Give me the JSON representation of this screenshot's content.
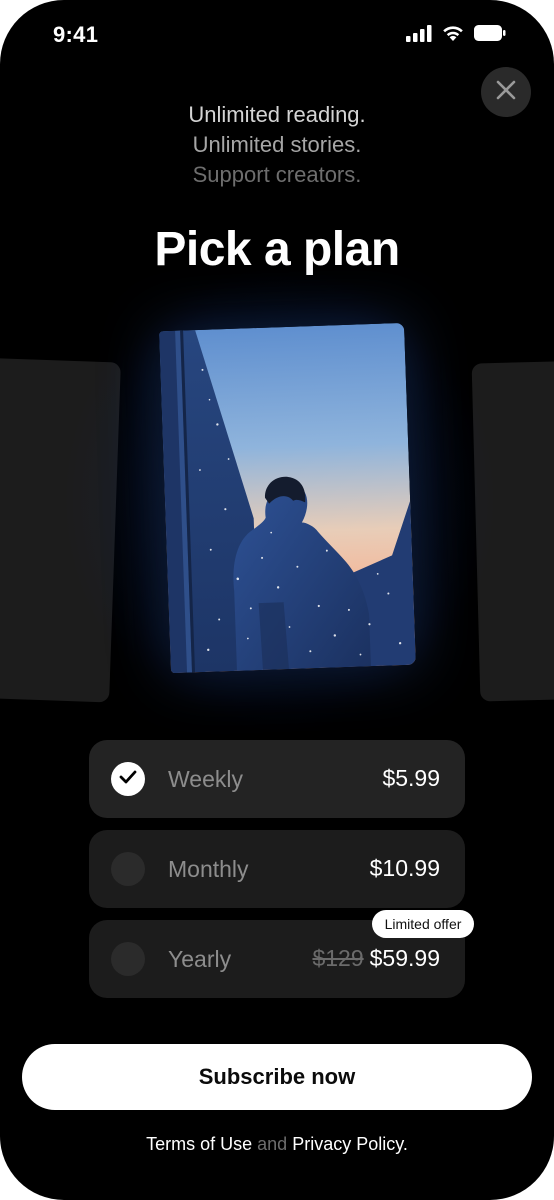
{
  "status_bar": {
    "time": "9:41"
  },
  "header": {
    "taglines": [
      "Unlimited reading.",
      "Unlimited stories.",
      "Support creators."
    ],
    "title": "Pick a plan"
  },
  "plans": [
    {
      "name": "Weekly",
      "price": "$5.99",
      "selected": true
    },
    {
      "name": "Monthly",
      "price": "$10.99",
      "selected": false
    },
    {
      "name": "Yearly",
      "old_price": "$129",
      "price": "$59.99",
      "badge": "Limited offer",
      "selected": false
    }
  ],
  "cta": {
    "label": "Subscribe now"
  },
  "footer": {
    "terms": "Terms of Use",
    "and": "and",
    "privacy": "Privacy Policy."
  },
  "icons": [
    "signal-icon",
    "wifi-icon",
    "battery-icon",
    "close-icon",
    "check-icon"
  ],
  "colors": {
    "background": "#000000",
    "card": "#1c1c1c",
    "accent": "#ffffff",
    "muted": "#8d8d8d"
  }
}
